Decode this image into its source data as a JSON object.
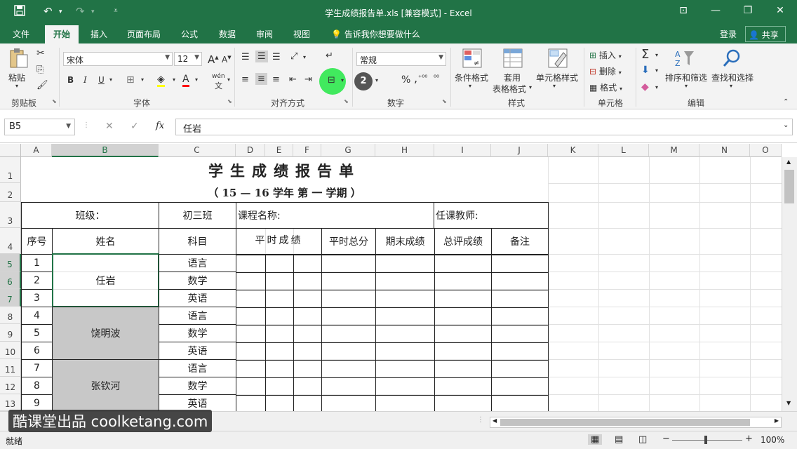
{
  "window": {
    "title": "学生成绩报告单.xls  [兼容模式] - Excel",
    "minimize": "—",
    "restore": "❐",
    "close": "✕",
    "ribbon_options": "⊡"
  },
  "tabs": [
    {
      "label": "文件"
    },
    {
      "label": "开始"
    },
    {
      "label": "插入"
    },
    {
      "label": "页面布局"
    },
    {
      "label": "公式"
    },
    {
      "label": "数据"
    },
    {
      "label": "审阅"
    },
    {
      "label": "视图"
    }
  ],
  "tell_me": "告诉我你想要做什么",
  "login": "登录",
  "share": "共享",
  "ribbon": {
    "paste": "粘贴",
    "font_name": "宋体",
    "font_size": "12",
    "wen": "wén",
    "number_format": "常规",
    "conditional_format": "条件格式",
    "table_format_1": "套用",
    "table_format_2": "表格格式",
    "cell_styles": "单元格样式",
    "insert": "插入",
    "delete": "删除",
    "format": "格式",
    "sort_filter": "排序和筛选",
    "find_select": "查找和选择",
    "groups": {
      "clipboard": "剪贴板",
      "font": "字体",
      "alignment": "对齐方式",
      "number": "数字",
      "styles": "样式",
      "cells": "单元格",
      "editing": "编辑"
    },
    "bold": "B",
    "italic": "I",
    "underline": "U",
    "percent": "%",
    "comma": ","
  },
  "badge": "2",
  "formula": {
    "name_box": "B5",
    "content": "任岩",
    "fx": "fx"
  },
  "columns": [
    "A",
    "B",
    "C",
    "D",
    "E",
    "F",
    "G",
    "H",
    "I",
    "J",
    "K",
    "L",
    "M",
    "N",
    "O"
  ],
  "rows": [
    "1",
    "2",
    "3",
    "4",
    "5",
    "6",
    "7",
    "8",
    "9",
    "10",
    "11",
    "12",
    "13"
  ],
  "sheet": {
    "title": "学生成绩报告单",
    "subtitle": "（ 15 — 16  学年 第 一 学期 ）",
    "class_label": "班级：",
    "class_value": "初三班",
    "course_label": "课程名称:",
    "teacher_label": "任课教师:",
    "headers": [
      "序号",
      "姓名",
      "科目",
      "平时成绩",
      "平时总分",
      "期末成绩",
      "总评成绩",
      "备注"
    ],
    "numbers": [
      "1",
      "2",
      "3",
      "4",
      "5",
      "6",
      "7",
      "8",
      "9"
    ],
    "names": [
      "任岩",
      "饶明波",
      "张钦河"
    ],
    "subjects": [
      "语言",
      "数学",
      "英语",
      "语言",
      "数学",
      "英语",
      "语言",
      "数学",
      "英语"
    ]
  },
  "status": {
    "ready": "就绪",
    "zoom": "100%",
    "zoom_minus": "−",
    "zoom_plus": "+"
  },
  "watermark": "酷课堂出品 coolketang.com",
  "colors": {
    "excel_green": "#217346",
    "highlight": "#2ee84e",
    "gray_fill": "#c8c8c8"
  }
}
